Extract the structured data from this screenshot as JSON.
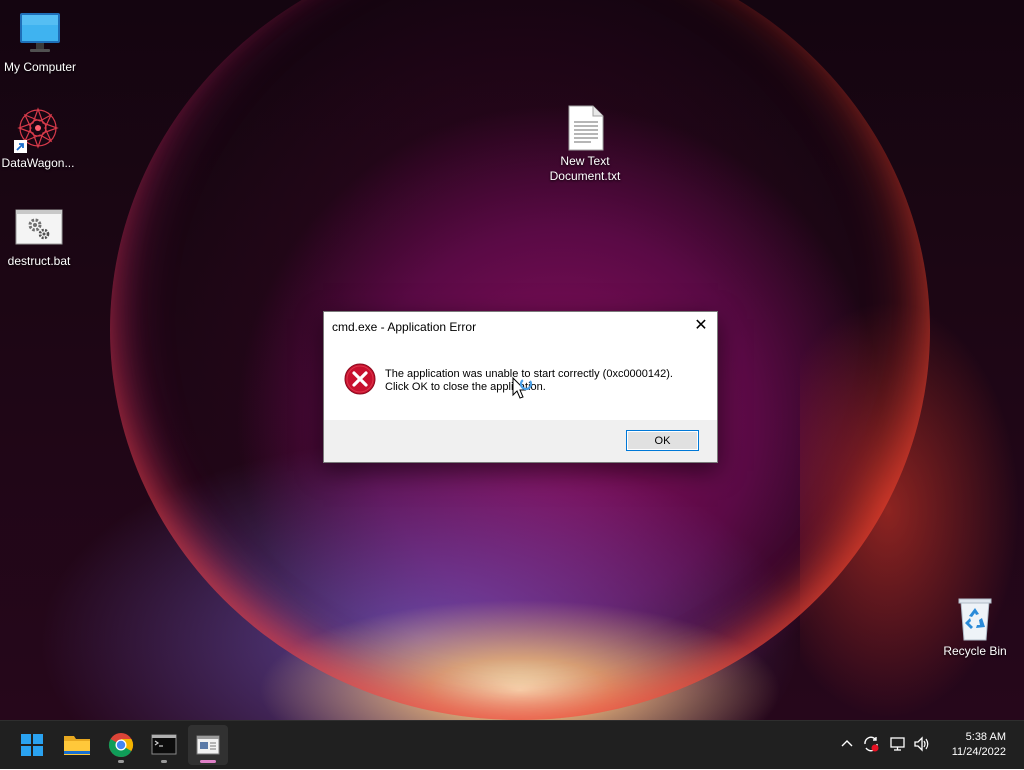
{
  "desktop": {
    "icons": [
      {
        "label": "My Computer",
        "icon": "monitor-icon"
      },
      {
        "label": "DataWagon...",
        "icon": "datawagon-shortcut-icon"
      },
      {
        "label": "destruct.bat",
        "icon": "batch-file-icon"
      },
      {
        "label": "New Text Document.txt",
        "icon": "text-document-icon"
      },
      {
        "label": "Recycle Bin",
        "icon": "recycle-bin-icon"
      }
    ]
  },
  "dialog": {
    "title": "cmd.exe - Application Error",
    "close_glyph": "✕",
    "message_line1": "The application was unable to start correctly (0xc0000142).",
    "message_line2": "Click OK to close the application.",
    "ok_label": "OK",
    "icon": "error-icon"
  },
  "taskbar": {
    "apps": [
      {
        "name": "start",
        "icon": "windows-start-icon"
      },
      {
        "name": "file-explorer",
        "icon": "folder-icon"
      },
      {
        "name": "chrome",
        "icon": "chrome-icon"
      },
      {
        "name": "terminal",
        "icon": "terminal-icon"
      },
      {
        "name": "active-window",
        "icon": "app-window-icon"
      }
    ],
    "tray": [
      "chevron-up-icon",
      "sync-icon",
      "network-icon",
      "volume-icon"
    ],
    "time": "5:38 AM",
    "date": "11/24/2022"
  },
  "colors": {
    "taskbar_bg": "#202020",
    "error_red": "#c8102e",
    "accent_blue": "#0078d7",
    "active_indicator": "#e080c8"
  }
}
